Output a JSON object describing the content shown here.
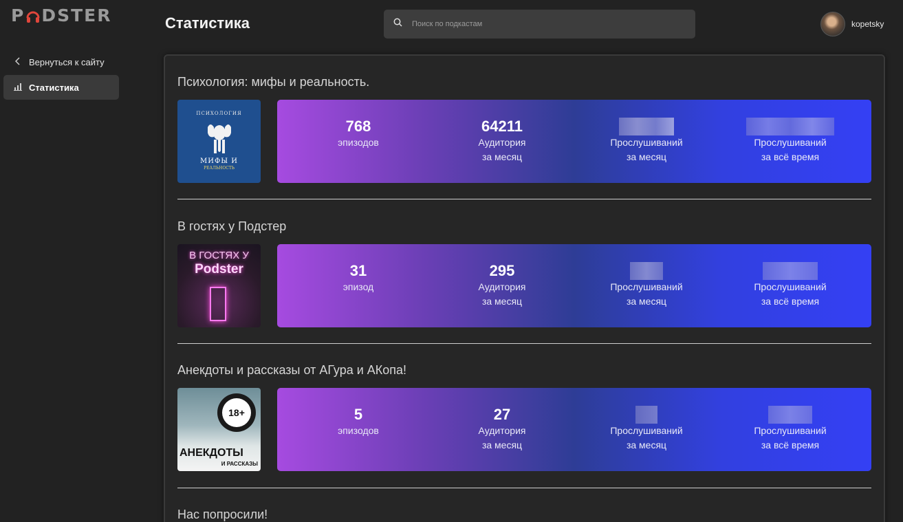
{
  "brand": {
    "logo_text_pre": "P",
    "logo_text_post": "DSTER"
  },
  "sidebar": {
    "back_label": "Вернуться к сайту",
    "active_label": "Статистика"
  },
  "header": {
    "title": "Статистика",
    "search_placeholder": "Поиск по подкастам",
    "username": "kopetsky"
  },
  "podcasts": [
    {
      "title": "Психология: мифы и реальность.",
      "cover_text_top": "ПСИХОЛОГИЯ",
      "cover_text_mid": "МИФЫ И",
      "cover_text_bot": "РЕАЛЬНОСТЬ",
      "episodes": "768",
      "episodes_label": "эпизодов",
      "audience": "64211",
      "audience_label_1": "Аудитория",
      "audience_label_2": "за месяц",
      "listens_month_label_1": "Прослушиваний",
      "listens_month_label_2": "за месяц",
      "listens_all_label_1": "Прослушиваний",
      "listens_all_label_2": "за всё время"
    },
    {
      "title": "В гостях у Подстер",
      "cover_text_top": "В ГОСТЯХ У",
      "cover_text_mid": "Podster",
      "episodes": "31",
      "episodes_label": "эпизод",
      "audience": "295",
      "audience_label_1": "Аудитория",
      "audience_label_2": "за месяц",
      "listens_month_label_1": "Прослушиваний",
      "listens_month_label_2": "за месяц",
      "listens_all_label_1": "Прослушиваний",
      "listens_all_label_2": "за всё время"
    },
    {
      "title": "Анекдоты и рассказы от АГура и АКопа!",
      "cover_text_top": "18+",
      "cover_text_mid": "АНЕКДОТЫ",
      "cover_text_bot": "И РАССКАЗЫ",
      "episodes": "5",
      "episodes_label": "эпизодов",
      "audience": "27",
      "audience_label_1": "Аудитория",
      "audience_label_2": "за месяц",
      "listens_month_label_1": "Прослушиваний",
      "listens_month_label_2": "за месяц",
      "listens_all_label_1": "Прослушиваний",
      "listens_all_label_2": "за всё время"
    },
    {
      "title": "Нас попросили!"
    }
  ],
  "colors": {
    "background": "#222222",
    "gradient_start": "#a64be0",
    "gradient_mid": "#2e3d96",
    "gradient_end": "#3440f4"
  }
}
